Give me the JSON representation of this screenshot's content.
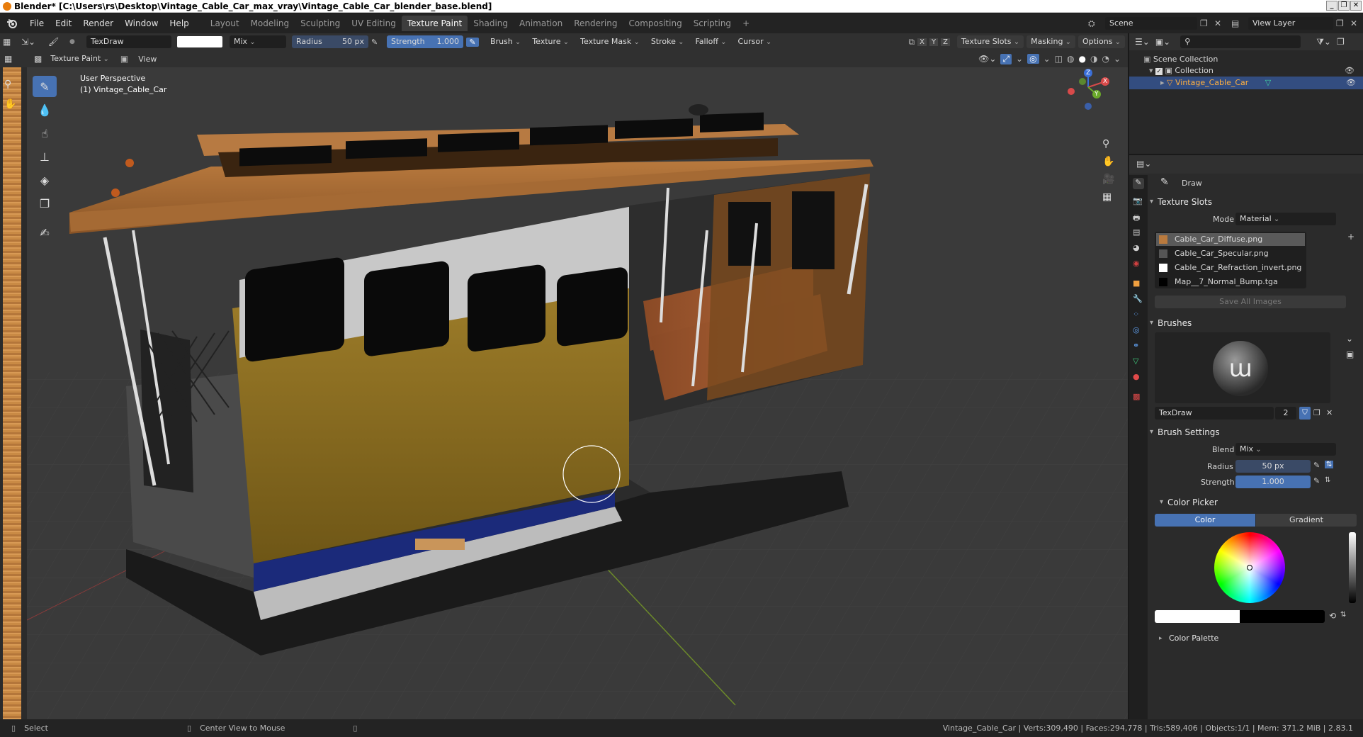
{
  "window": {
    "title": "Blender* [C:\\Users\\rs\\Desktop\\Vintage_Cable_Car_max_vray\\Vintage_Cable_Car_blender_base.blend]",
    "controls": [
      "_",
      "❐",
      "✕"
    ]
  },
  "menu": [
    "File",
    "Edit",
    "Render",
    "Window",
    "Help"
  ],
  "workspaces": [
    {
      "label": "Layout",
      "active": false
    },
    {
      "label": "Modeling",
      "active": false
    },
    {
      "label": "Sculpting",
      "active": false
    },
    {
      "label": "UV Editing",
      "active": false
    },
    {
      "label": "Texture Paint",
      "active": true
    },
    {
      "label": "Shading",
      "active": false
    },
    {
      "label": "Animation",
      "active": false
    },
    {
      "label": "Rendering",
      "active": false
    },
    {
      "label": "Compositing",
      "active": false
    },
    {
      "label": "Scripting",
      "active": false
    }
  ],
  "scene": {
    "scene_name": "Scene",
    "view_layer": "View Layer"
  },
  "tool_header": {
    "brush_name": "TexDraw",
    "blend_mode": "Mix",
    "radius_label": "Radius",
    "radius_value": "50 px",
    "strength_label": "Strength",
    "strength_value": "1.000",
    "menus": [
      "Brush",
      "Texture",
      "Texture Mask",
      "Stroke",
      "Falloff",
      "Cursor"
    ],
    "axes": [
      "X",
      "Y",
      "Z"
    ],
    "right_menus": [
      "Texture Slots",
      "Masking",
      "Options"
    ]
  },
  "header2": {
    "mode": "Texture Paint",
    "view": "View"
  },
  "viewport": {
    "perspective": "User Perspective",
    "object_label": "(1) Vintage_Cable_Car",
    "gizmo": {
      "x": "X",
      "y": "Y",
      "z": "Z"
    }
  },
  "outliner": {
    "root": "Scene Collection",
    "collection": "Collection",
    "object": "Vintage_Cable_Car"
  },
  "properties": {
    "tool_name": "Draw",
    "texture_slots_title": "Texture Slots",
    "mode_label": "Mode",
    "mode_value": "Material",
    "slots": [
      "Cable_Car_Diffuse.png",
      "Cable_Car_Specular.png",
      "Cable_Car_Refraction_invert.png",
      "Map__7_Normal_Bump.tga"
    ],
    "save_all": "Save All Images",
    "brushes_title": "Brushes",
    "brush_name": "TexDraw",
    "brush_users": "2",
    "brush_settings_title": "Brush Settings",
    "blend_label": "Blend",
    "blend_value": "Mix",
    "radius_label": "Radius",
    "radius_value": "50 px",
    "strength_label": "Strength",
    "strength_value": "1.000",
    "color_picker_title": "Color Picker",
    "color_tab": "Color",
    "gradient_tab": "Gradient",
    "color_palette_title": "Color Palette"
  },
  "status": {
    "select": "Select",
    "center_view": "Center View to Mouse",
    "stats": "Vintage_Cable_Car | Verts:309,490 | Faces:294,778 | Tris:589,406 | Objects:1/1 | Mem: 371.2 MiB | 2.83.1"
  },
  "colors": {
    "accent": "#4772b3",
    "brush_color": "#ffffff",
    "active_highlight": "#3a5688"
  }
}
